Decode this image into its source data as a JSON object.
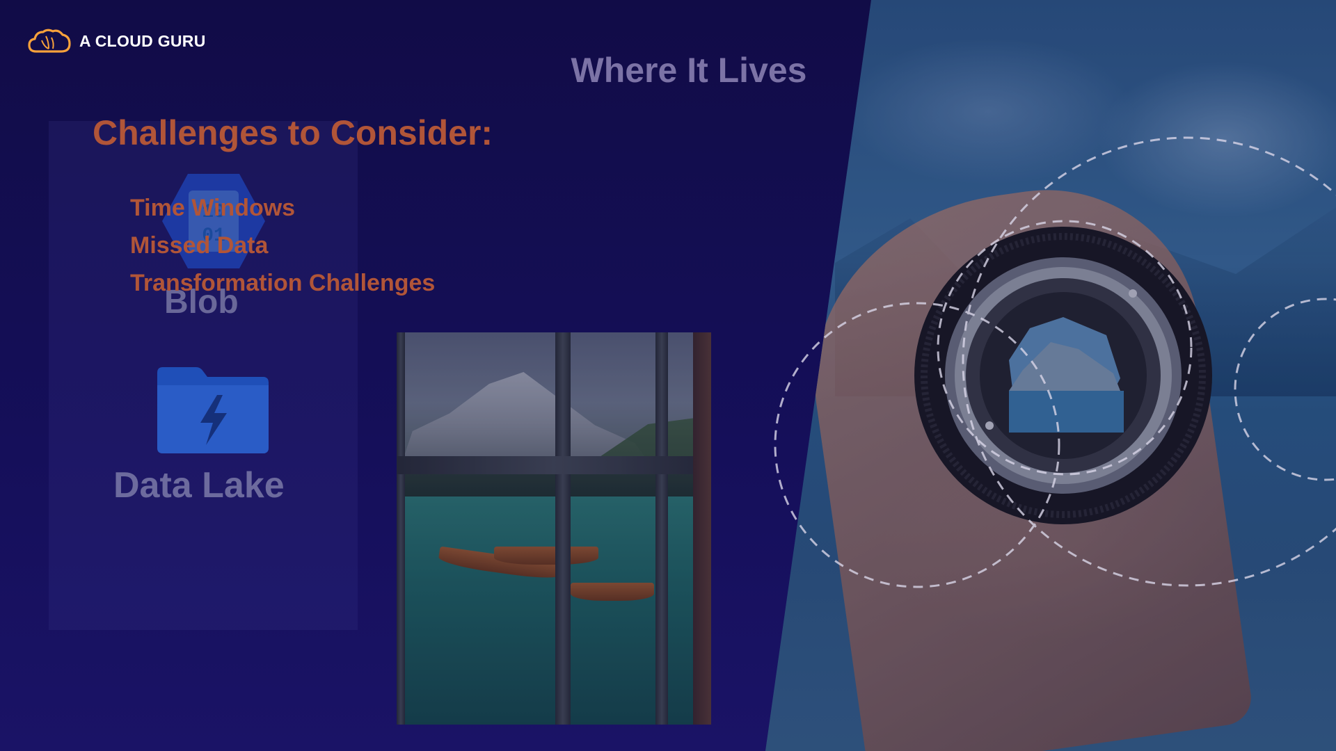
{
  "brand": {
    "name": "A CLOUD GURU",
    "logo_icon": "cloud-icon",
    "logo_color": "#f7a13b"
  },
  "slide": {
    "heading_secondary": "Where It Lives",
    "heading_primary": "Challenges to Consider:",
    "bullets": [
      "Time Windows",
      "Missed Data",
      "Transformation Challenges"
    ],
    "storage_items": [
      {
        "label": "Blob",
        "icon": "blob-storage-icon"
      },
      {
        "label": "Data Lake",
        "icon": "data-lake-folder-icon"
      }
    ],
    "images": [
      {
        "name": "window-lake-photo",
        "subject": "lake-view-through-window"
      },
      {
        "name": "camera-lens-photo",
        "subject": "hand-holding-camera-lens"
      }
    ]
  },
  "colors": {
    "background": "#110c47",
    "accent": "#b15538",
    "muted_heading": "#7c73a6",
    "icon_blue": "#1f4fb8"
  }
}
